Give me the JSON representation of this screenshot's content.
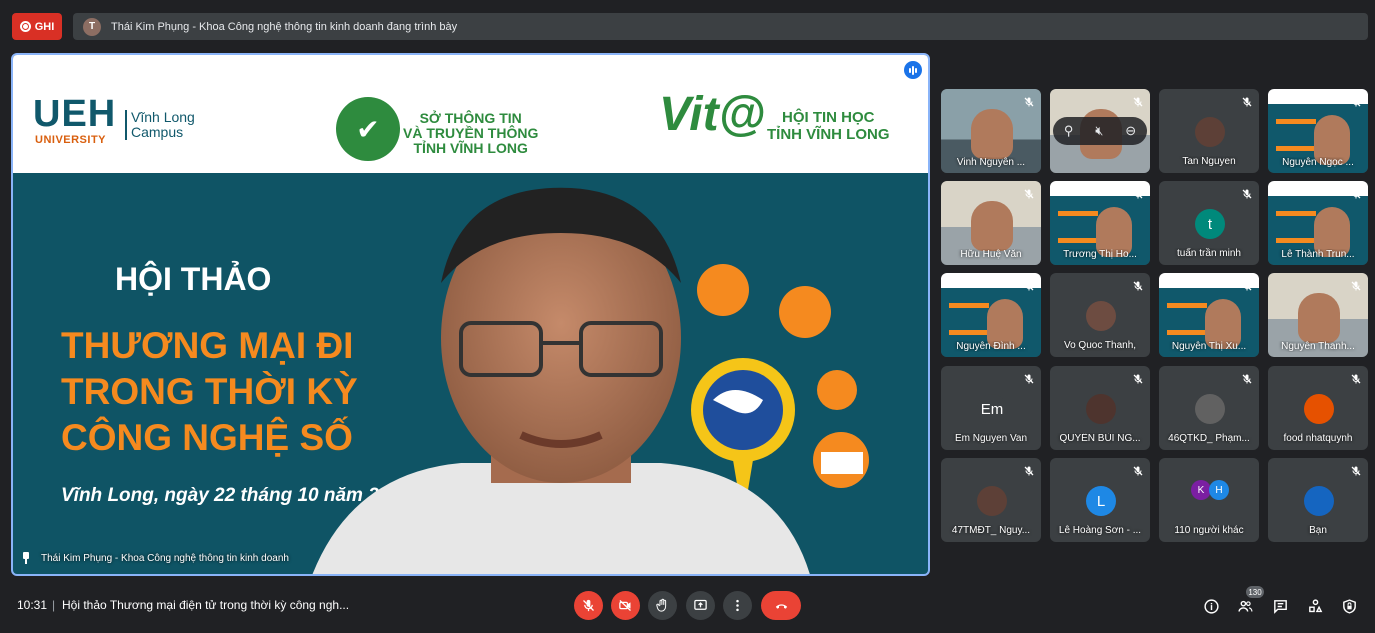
{
  "topbar": {
    "record_label": "GHI",
    "presenter_initial": "T",
    "presenting_text": "Thái Kim Phụng - Khoa Công nghệ thông tin kinh doanh đang trình bày"
  },
  "main": {
    "slide": {
      "ueh": "UEH",
      "ueh_sub": "UNIVERSITY",
      "campus_line1": "Vĩnh Long",
      "campus_line2": "Campus",
      "so_line1": "SỞ THÔNG TIN",
      "so_line2": "VÀ TRUYỀN THÔNG",
      "so_line3": "TỈNH VĨNH LONG",
      "vit": "Vit@",
      "hoi_line1": "HỘI TIN HỌC",
      "hoi_line2": "TỈNH VĨNH LONG",
      "hoithao": "HỘI THẢO",
      "title_line1": "THƯƠNG MẠI ĐI",
      "title_line2": "TRONG THỜI KỲ",
      "title_line3": "CÔNG NGHỆ SỐ",
      "date": "Vĩnh Long, ngày 22 tháng 10 năm 2"
    },
    "label": "Thái Kim Phụng - Khoa Công nghệ thông tin kinh doanh"
  },
  "participants": [
    {
      "name": "Vinh Nguyễn ...",
      "kind": "face"
    },
    {
      "name": "",
      "kind": "room"
    },
    {
      "name": "Tan Nguyen",
      "kind": "avatar-photo",
      "color": "#5d4037"
    },
    {
      "name": "Nguyễn Ngọc ...",
      "kind": "slide"
    },
    {
      "name": "Hữu Huệ Văn",
      "kind": "room"
    },
    {
      "name": "Trương Thị Ho...",
      "kind": "slide"
    },
    {
      "name": "tuấn trần minh",
      "kind": "avatar",
      "initial": "t",
      "color": "#00897b"
    },
    {
      "name": "Lê Thành Trun...",
      "kind": "slide"
    },
    {
      "name": "Nguyễn Đình ...",
      "kind": "slide"
    },
    {
      "name": "Vo Quoc Thanh,",
      "kind": "avatar-photo",
      "color": "#6d4c41"
    },
    {
      "name": "Nguyễn Thị Xu...",
      "kind": "slide"
    },
    {
      "name": "Nguyễn Thanh...",
      "kind": "room"
    },
    {
      "name": "Em Nguyen Van",
      "kind": "avatar",
      "initial": "Em",
      "color": "#3c4043"
    },
    {
      "name": "QUYÊN BÙI NG...",
      "kind": "avatar-photo",
      "color": "#4e342e"
    },
    {
      "name": "46QTKD_ Phạm...",
      "kind": "avatar-photo",
      "color": "#616161"
    },
    {
      "name": "food nhatquynh",
      "kind": "avatar-photo",
      "color": "#e65100"
    },
    {
      "name": "47TMĐT_ Nguy...",
      "kind": "avatar-photo",
      "color": "#5d4037"
    },
    {
      "name": "Lê Hoàng Sơn - ...",
      "kind": "avatar",
      "initial": "L",
      "color": "#1e88e5"
    },
    {
      "name": "110 người khác",
      "kind": "others",
      "initials": [
        "K",
        "H"
      ]
    },
    {
      "name": "Bạn",
      "kind": "avatar-photo",
      "color": "#1565c0"
    }
  ],
  "bottombar": {
    "time": "10:31",
    "separator": "|",
    "meeting_title": "Hội thảo Thương mại điện tử trong thời kỳ công ngh...",
    "participant_count": "130"
  },
  "colors": {
    "accent": "#8ab4f8",
    "danger": "#ea4335",
    "bg": "#202124",
    "tile": "#3c4043"
  }
}
